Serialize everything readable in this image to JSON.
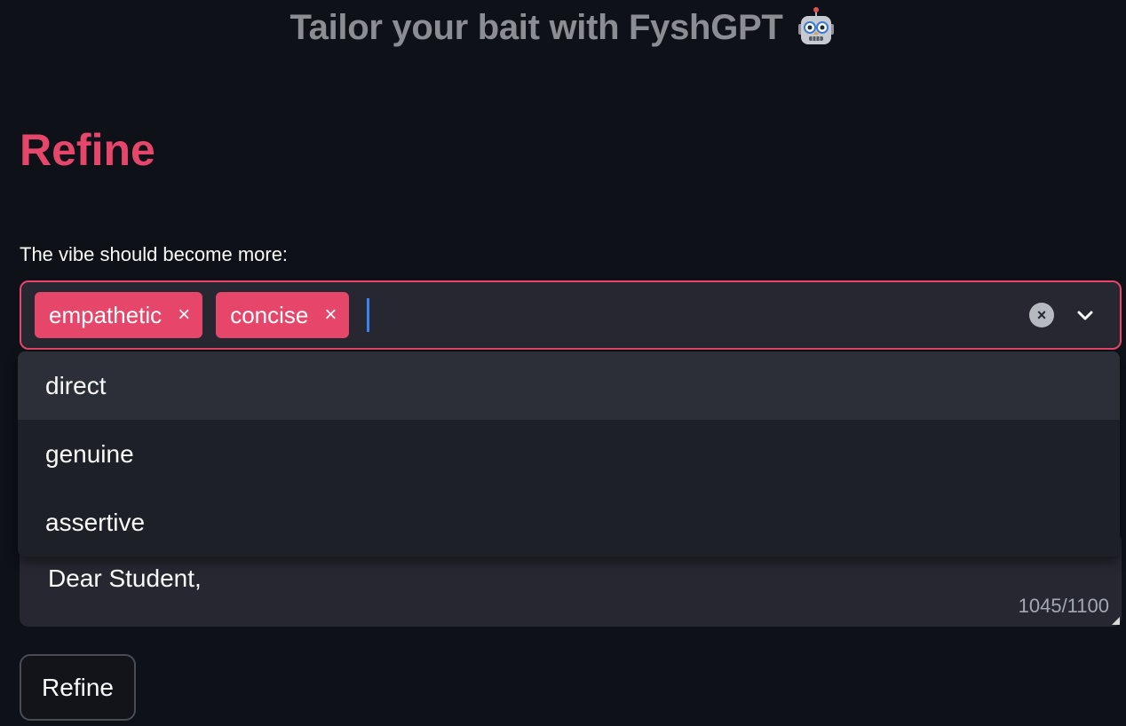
{
  "app": {
    "title": "Tailor your bait with FyshGPT",
    "title_icon": "robot-face-icon"
  },
  "section": {
    "heading": "Refine"
  },
  "vibe_select": {
    "label": "The vibe should become more:",
    "selected": [
      {
        "label": "empathetic",
        "remove_symbol": "×"
      },
      {
        "label": "concise",
        "remove_symbol": "×"
      }
    ],
    "clear_icon": "clear-circle-icon",
    "clear_symbol": "×",
    "dropdown_icon": "chevron-down-icon",
    "options": [
      "direct",
      "genuine",
      "assertive"
    ],
    "highlighted_option": "direct"
  },
  "message_area": {
    "visible_text": "Dear Student,",
    "char_count": "1045/1100"
  },
  "refine_button": {
    "label": "Refine"
  },
  "colors": {
    "background": "#0e1117",
    "accent": "#e5466a",
    "input_bg": "#262730",
    "caret": "#3b82f6"
  }
}
